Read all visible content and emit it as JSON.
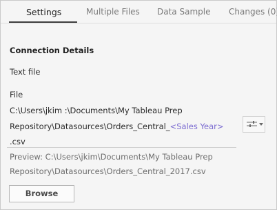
{
  "tabs": [
    {
      "label": "Settings"
    },
    {
      "label": "Multiple Files"
    },
    {
      "label": "Data Sample"
    },
    {
      "label": "Changes (0)"
    }
  ],
  "connection": {
    "title": "Connection Details",
    "type_text": "Text file",
    "file_label": "File",
    "path_line1": "C:\\Users\\jkim :\\Documents\\My Tableau Prep",
    "path_line2_prefix": "Repository\\Datasources\\Orders_Central_",
    "path_parameter": "<Sales Year>",
    "path_line3": ".csv"
  },
  "options_button": {
    "icon": "sliders-icon"
  },
  "preview": {
    "line1": "Preview: C:\\Users\\jkim\\Documents\\My Tableau Prep",
    "line2": "Repository\\Datasources\\Orders_Central_2017.csv"
  },
  "browse_label": "Browse",
  "colors": {
    "parameter": "#7b6bd1",
    "active_tab_underline": "#3d3d3d",
    "background": "#f5f5f5"
  }
}
